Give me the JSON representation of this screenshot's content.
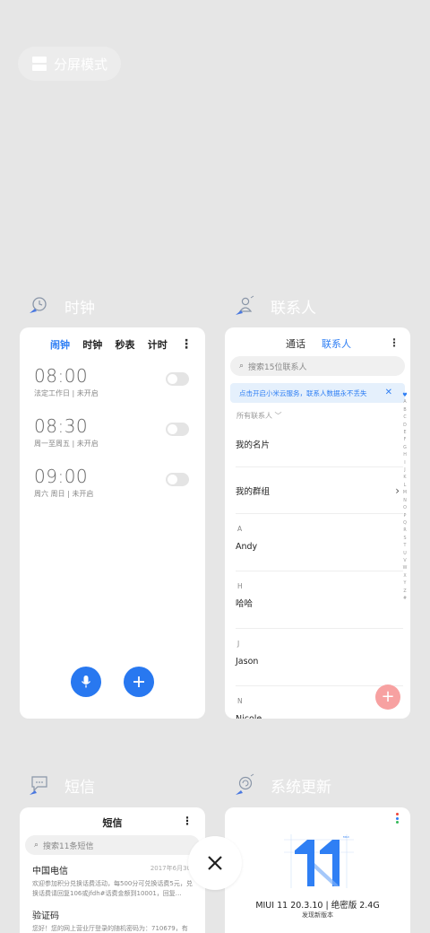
{
  "split_screen": {
    "label": "分屏模式"
  },
  "apps": {
    "clock": {
      "name": "时钟",
      "tabs": [
        "闹钟",
        "时钟",
        "秒表",
        "计时"
      ],
      "menu": "⋮",
      "alarms": [
        {
          "time": "08:00",
          "desc": "法定工作日 | 未开启",
          "enabled": false
        },
        {
          "time": "08:30",
          "desc": "周一至周五 | 未开启",
          "enabled": false
        },
        {
          "time": "09:00",
          "desc": "周六 周日 | 未开启",
          "enabled": false
        }
      ]
    },
    "contacts": {
      "name": "联系人",
      "tabs": [
        "通话",
        "联系人"
      ],
      "menu": "⋮",
      "search_placeholder": "搜索15位联系人",
      "cloud_tip": "点击开启小米云服务，联系人数据永不丢失",
      "cloud_tip_close": "✕",
      "all_contacts": "所有联系人",
      "my_card": "我的名片",
      "my_groups": "我的群组",
      "sections": [
        {
          "letter": "A",
          "name": "Andy"
        },
        {
          "letter": "H",
          "name": "哈哈"
        },
        {
          "letter": "J",
          "name": "Jason"
        },
        {
          "letter": "N",
          "name": "Nicole"
        }
      ],
      "index_letters": [
        "A",
        "B",
        "C",
        "D",
        "E",
        "F",
        "G",
        "H",
        "I",
        "J",
        "K",
        "L",
        "M",
        "N",
        "O",
        "P",
        "Q",
        "R",
        "S",
        "T",
        "U",
        "V",
        "W",
        "X",
        "Y",
        "Z",
        "#"
      ]
    },
    "sms": {
      "name": "短信",
      "title": "短信",
      "menu": "⋮",
      "search_placeholder": "搜索11条短信",
      "messages": [
        {
          "sender": "中国电信",
          "date": "2017年6月30",
          "body": "欢迎参加积分兑换话费活动，每500分可兑换话费5元，兑换话费请回复106或jfdh#话费金额到10001，回复…"
        },
        {
          "sender": "验证码",
          "date": "",
          "body": "您好！您的网上营业厅登录的随机密码为：710679，有"
        }
      ]
    },
    "updater": {
      "name": "系统更新",
      "version": "MIUI 11 20.3.10 | 绝密版 2.4G",
      "status": "发现新版本",
      "brand_colors": [
        "#f0453a",
        "#2f7ff4",
        "#34b95a"
      ]
    }
  },
  "close_all": {
    "icon": "close-icon"
  }
}
